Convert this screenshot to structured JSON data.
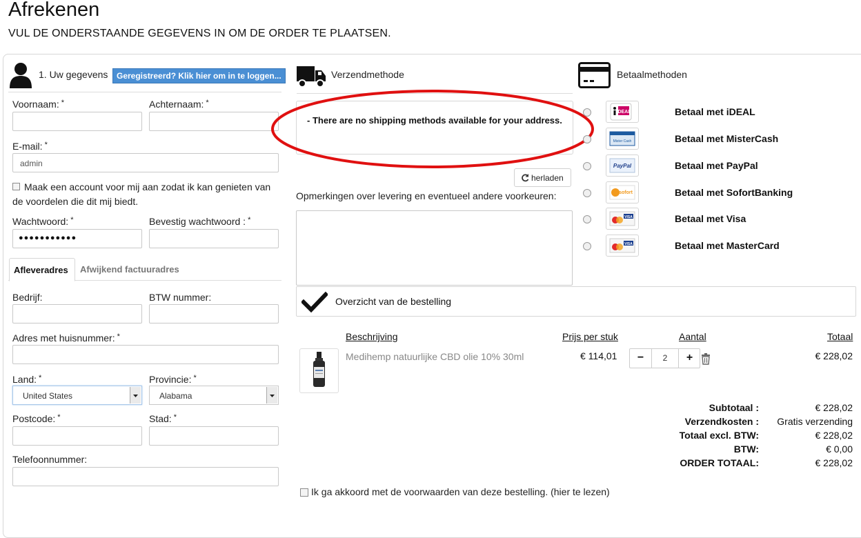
{
  "page": {
    "title": "Afrekenen",
    "subtitle": "VUL DE ONDERSTAANDE GEGEVENS IN OM DE ORDER TE PLAATSEN."
  },
  "details": {
    "heading": "1. Uw gegevens",
    "login_button": "Geregistreerd? Klik hier om in te loggen...",
    "first_name_label": "Voornaam:",
    "last_name_label": "Achternaam:",
    "email_label": "E-mail:",
    "email_value": "admin",
    "create_account_text": "Maak een account voor mij aan zodat ik kan genieten van de voordelen die dit mij biedt.",
    "password_label": "Wachtwoord:",
    "password_value": "●●●●●●●●●●●",
    "confirm_password_label": "Bevestig wachtwoord :",
    "req_mark": "*",
    "tab_delivery": "Afleveradres",
    "tab_billing": "Afwijkend factuuradres",
    "company_label": "Bedrijf:",
    "vat_label": "BTW nummer:",
    "address_label": "Adres met huisnummer:",
    "country_label": "Land:",
    "country_value": "United States",
    "province_label": "Provincie:",
    "province_value": "Alabama",
    "postcode_label": "Postcode:",
    "city_label": "Stad:",
    "phone_label": "Telefoonnummer:"
  },
  "shipping": {
    "heading": "Verzendmethode",
    "message": "- There are no shipping methods available for your address.",
    "reload_button": "herladen",
    "remarks_label": "Opmerkingen over levering en eventueel andere voorkeuren:"
  },
  "payment": {
    "heading": "Betaalmethoden",
    "methods": [
      {
        "label": "Betaal met iDEAL",
        "logo": "ideal-logo",
        "logo_text": "iDEAL"
      },
      {
        "label": "Betaal met MisterCash",
        "logo": "mistercash-logo",
        "logo_text": "Mister Cash"
      },
      {
        "label": "Betaal met PayPal",
        "logo": "paypal-logo",
        "logo_text": "PayPal"
      },
      {
        "label": "Betaal met SofortBanking",
        "logo": "sofort-logo",
        "logo_text": "sofort"
      },
      {
        "label": "Betaal met Visa",
        "logo": "visa-logo",
        "logo_text": "VISA"
      },
      {
        "label": "Betaal met MasterCard",
        "logo": "mastercard-logo",
        "logo_text": "VISA"
      }
    ]
  },
  "order": {
    "heading": "Overzicht van de bestelling",
    "col_description": "Beschrijving",
    "col_unit_price": "Prijs per stuk",
    "col_quantity": "Aantal",
    "col_total": "Totaal",
    "item": {
      "name": "Medihemp natuurlijke CBD olie 10% 30ml",
      "unit_price": "€ 114,01",
      "quantity": "2",
      "total": "€ 228,02",
      "minus": "−",
      "plus": "+"
    },
    "summary": [
      {
        "label": "Subtotaal :",
        "value": "€ 228,02"
      },
      {
        "label": "Verzendkosten :",
        "value": "Gratis verzending"
      },
      {
        "label": "Totaal  excl. BTW:",
        "value": "€ 228,02"
      },
      {
        "label": "BTW:",
        "value": "€ 0,00"
      },
      {
        "label": "ORDER TOTAAL:",
        "value": "€ 228,02"
      }
    ],
    "terms_text": "Ik ga akkoord met de voorwaarden van deze bestelling. (hier te lezen)"
  },
  "colors": {
    "annotation_circle": "#e01010",
    "login_button_bg": "#4a8fd4"
  }
}
